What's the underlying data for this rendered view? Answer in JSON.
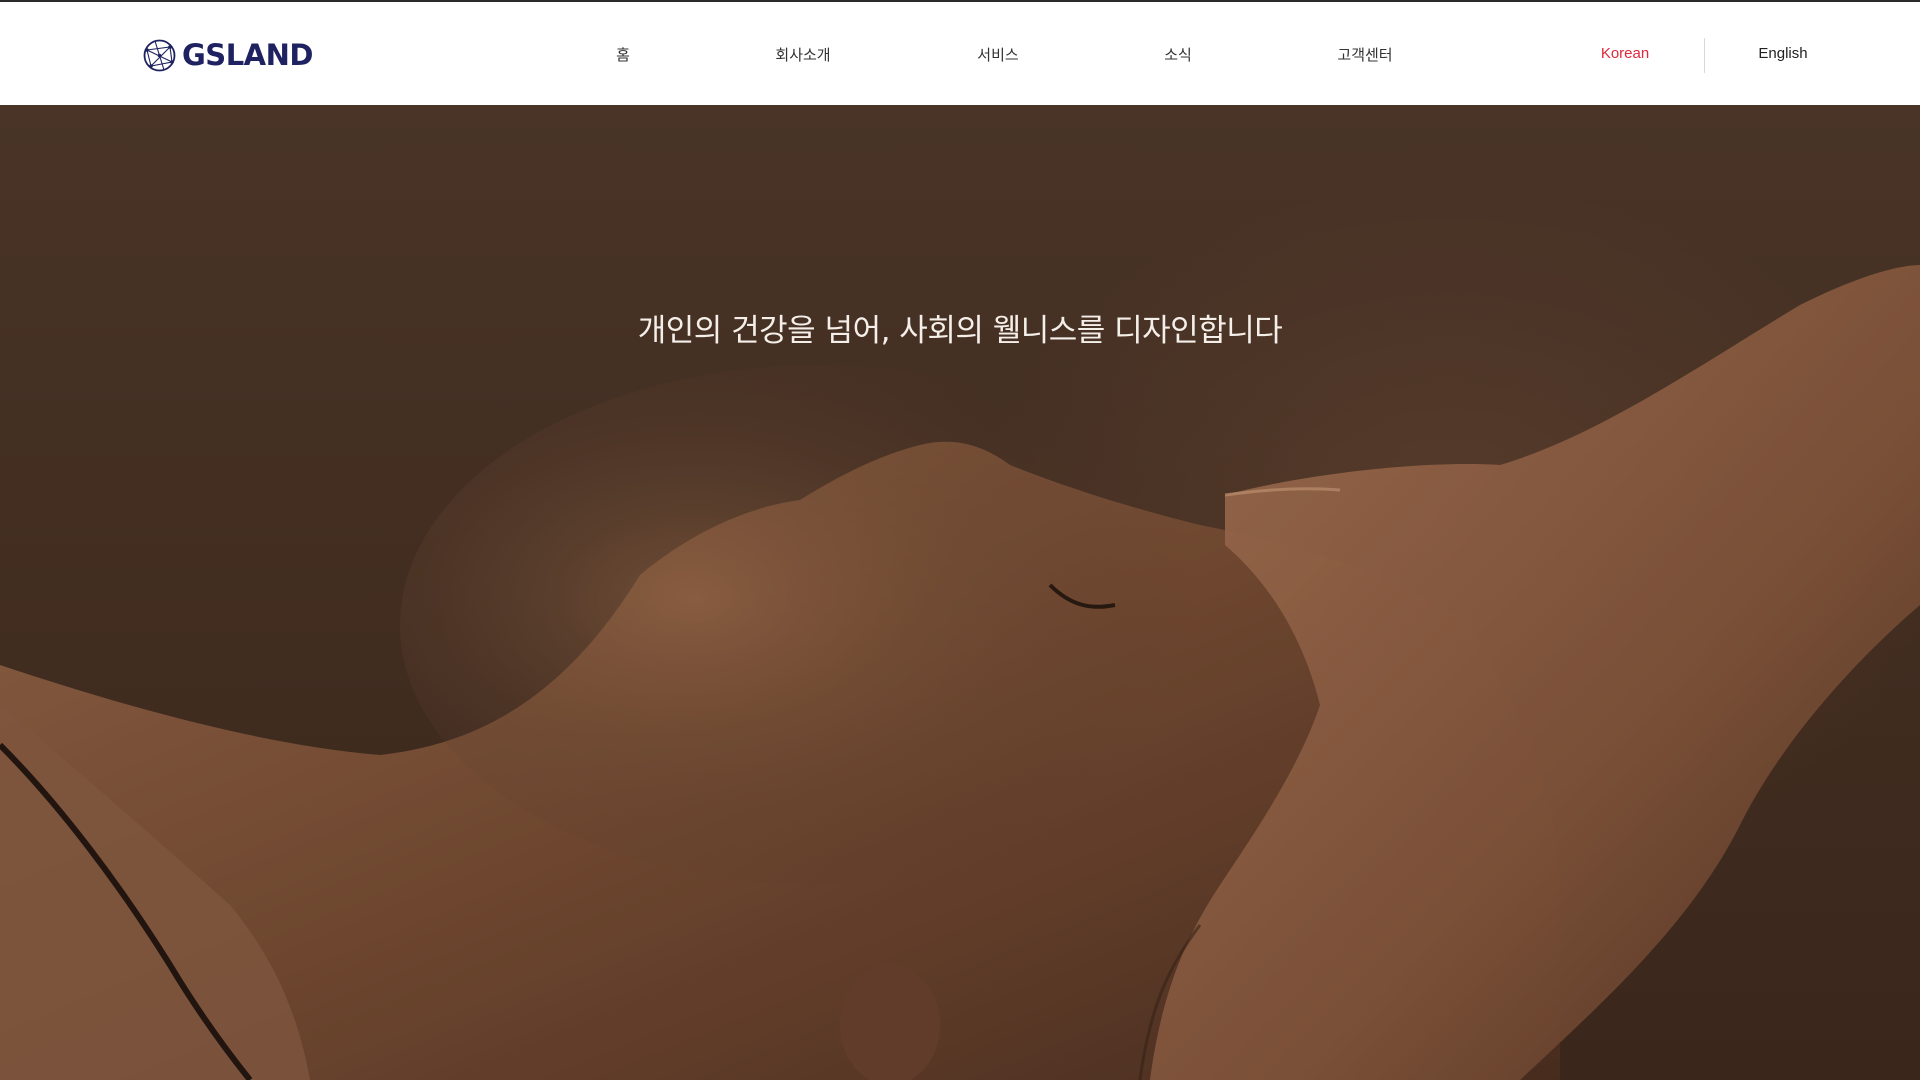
{
  "brand": {
    "logo_text": "GSLAND",
    "logo_icon": "globe-icon",
    "color": "#1f2260"
  },
  "nav": {
    "items": [
      {
        "label": "홈"
      },
      {
        "label": "회사소개"
      },
      {
        "label": "서비스"
      },
      {
        "label": "소식"
      },
      {
        "label": "고객센터"
      }
    ]
  },
  "language": {
    "korean": "Korean",
    "english": "English",
    "active": "Korean",
    "active_color": "#e0283a",
    "inactive_color": "#222222"
  },
  "hero": {
    "headline": "개인의 건강을 넘어, 사회의 웰니스를 디자인합니다",
    "image": "spa-head-massage-photo"
  }
}
